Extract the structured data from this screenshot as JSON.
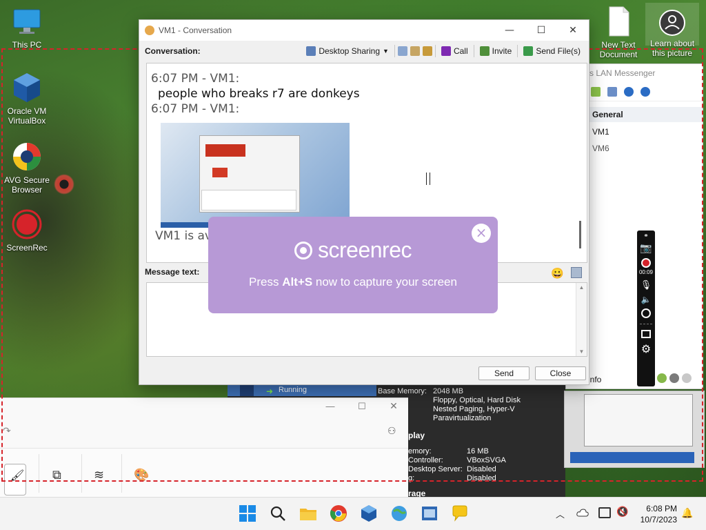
{
  "desktop": {
    "icons": [
      {
        "label": "This PC"
      },
      {
        "label": "Oracle VM VirtualBox"
      },
      {
        "label": "AVG Secure Browser"
      },
      {
        "label": "ScreenRec"
      },
      {
        "label": "New Text Document"
      },
      {
        "label": "Learn about this picture"
      }
    ]
  },
  "conversation": {
    "title": "VM1 - Conversation",
    "label": "Conversation:",
    "toolbar": {
      "desktop_sharing": "Desktop Sharing",
      "call": "Call",
      "invite": "Invite",
      "send_files": "Send File(s)"
    },
    "messages": [
      {
        "meta": "6:07 PM - VM1:",
        "body": "people who breaks r7 are donkeys"
      },
      {
        "meta": "6:07 PM - VM1:",
        "body": ""
      }
    ],
    "status_partial": "VM1 is ava",
    "message_label": "Message text:",
    "send_label": "Send",
    "close_label": "Close"
  },
  "screenrec_popup": {
    "brand": "screenrec",
    "hint_prefix": "Press ",
    "hint_key": "Alt+S",
    "hint_suffix": " now to capture your screen",
    "close": "×"
  },
  "lan_messenger": {
    "title_partial": "s LAN Messenger",
    "group": "General",
    "users": [
      "VM1",
      "VM6"
    ],
    "info_partial": "y Info"
  },
  "screenrec_side": {
    "timer": "00:09"
  },
  "virtualbox": {
    "running": "Running",
    "details": [
      {
        "key": "Base Memory:",
        "value": "2048 MB"
      },
      {
        "key": "er:",
        "value": "Floppy, Optical, Hard Disk"
      },
      {
        "key": "ation:",
        "value": "Nested Paging, Hyper-V"
      },
      {
        "key": "",
        "value": "Paravirtualization"
      }
    ],
    "section_display": "play",
    "display_details": [
      {
        "key": "emory:",
        "value": "16 MB"
      },
      {
        "key": "Controller:",
        "value": "VBoxSVGA"
      },
      {
        "key": "Desktop Server:",
        "value": "Disabled"
      },
      {
        "key": "g:",
        "value": "Disabled"
      }
    ],
    "section_storage": "rage"
  },
  "taskbar": {
    "time": "6:08 PM",
    "date": "10/7/2023"
  },
  "colors": {
    "accent_purple": "#b799d6",
    "rec_red": "#d6232a"
  }
}
